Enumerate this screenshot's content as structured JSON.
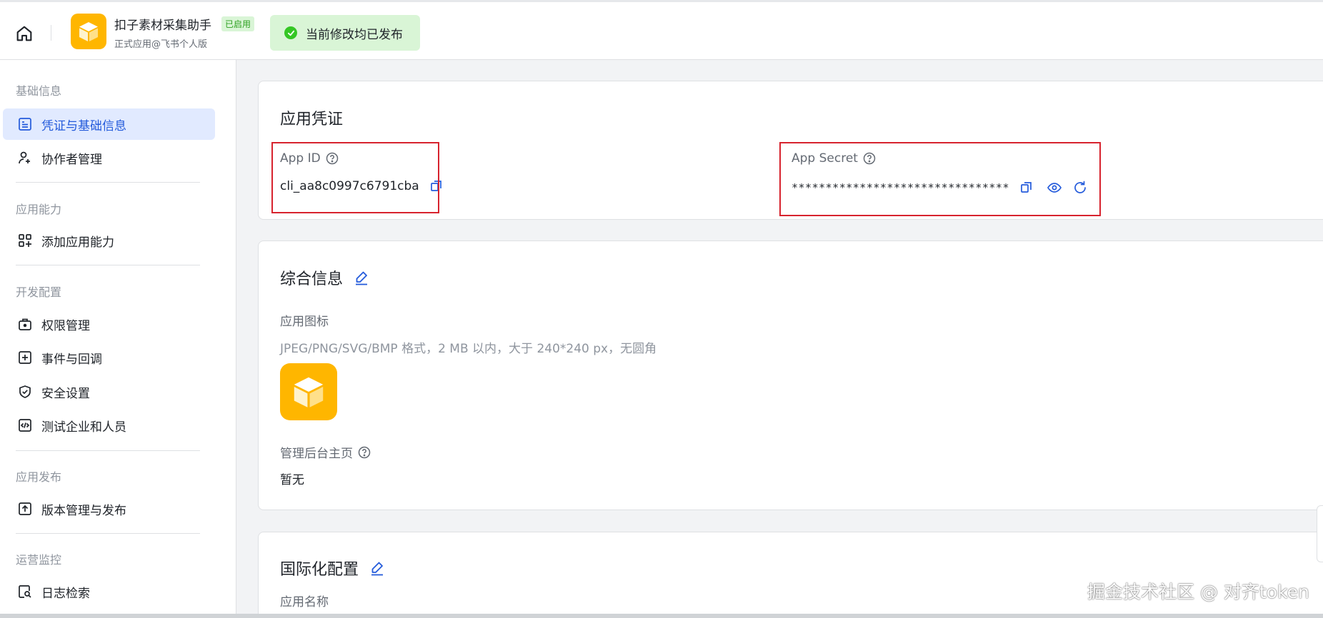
{
  "header": {
    "app_name": "扣子素材采集助手",
    "status_badge": "已启用",
    "app_subtitle": "正式应用@飞书个人版",
    "publish_status": "当前修改均已发布"
  },
  "sidebar": {
    "sections": [
      {
        "title": "基础信息",
        "items": [
          {
            "label": "凭证与基础信息",
            "icon": "credential-icon",
            "active": true
          },
          {
            "label": "协作者管理",
            "icon": "user-add-icon"
          }
        ]
      },
      {
        "title": "应用能力",
        "items": [
          {
            "label": "添加应用能力",
            "icon": "apps-add-icon"
          }
        ]
      },
      {
        "title": "开发配置",
        "items": [
          {
            "label": "权限管理",
            "icon": "permission-icon"
          },
          {
            "label": "事件与回调",
            "icon": "event-icon"
          },
          {
            "label": "安全设置",
            "icon": "shield-icon"
          },
          {
            "label": "测试企业和人员",
            "icon": "code-icon"
          }
        ]
      },
      {
        "title": "应用发布",
        "items": [
          {
            "label": "版本管理与发布",
            "icon": "upload-icon"
          }
        ]
      },
      {
        "title": "运营监控",
        "items": [
          {
            "label": "日志检索",
            "icon": "log-search-icon"
          }
        ]
      }
    ]
  },
  "credentials": {
    "title": "应用凭证",
    "app_id_label": "App ID",
    "app_id_value": "cli_aa8c0997c6791cba",
    "app_secret_label": "App Secret",
    "app_secret_value": "********************************"
  },
  "general": {
    "title": "综合信息",
    "icon_label": "应用图标",
    "icon_hint": "JPEG/PNG/SVG/BMP 格式，2 MB 以内，大于 240*240 px，无圆角",
    "admin_home_label": "管理后台主页",
    "admin_home_value": "暂无"
  },
  "i18n": {
    "title": "国际化配置",
    "app_name_label": "应用名称"
  },
  "watermark": "掘金技术社区 @ 对齐token",
  "colors": {
    "accent": "#245bdb",
    "active_bg": "#e1eaff",
    "success": "#34c724",
    "highlight_box": "#d7232e",
    "app_logo": "#ffb600"
  }
}
